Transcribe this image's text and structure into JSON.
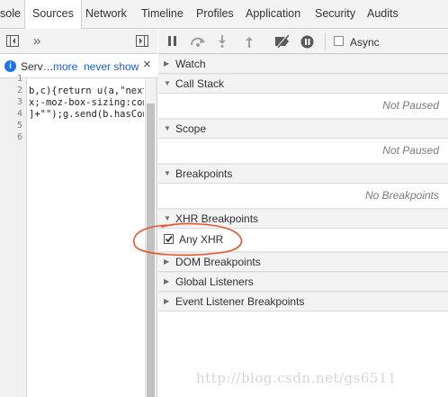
{
  "tabs": [
    {
      "label": "sole",
      "active": false
    },
    {
      "label": "Sources",
      "active": true
    },
    {
      "label": "Network",
      "active": false
    },
    {
      "label": "Timeline",
      "active": false
    },
    {
      "label": "Profiles",
      "active": false
    },
    {
      "label": "Application",
      "active": false
    },
    {
      "label": "Security",
      "active": false
    },
    {
      "label": "Audits",
      "active": false
    }
  ],
  "infobar": {
    "text": "Serv…",
    "more": "more",
    "never_show": "never show",
    "close": "×"
  },
  "editor": {
    "line_numbers": [
      "1",
      "2",
      "3",
      "4",
      "5",
      "6"
    ],
    "lines": [
      "",
      "b,c){return u(a,\"next\"",
      "x;-moz-box-sizing:cont",
      "]+\"\");g.send(b.hasCont",
      "",
      ""
    ]
  },
  "debugger_toolbar": {
    "async_label": "Async",
    "async_checked": false
  },
  "sections": {
    "watch": "Watch",
    "call_stack": {
      "label": "Call Stack",
      "status": "Not Paused"
    },
    "scope": {
      "label": "Scope",
      "status": "Not Paused"
    },
    "breakpoints": {
      "label": "Breakpoints",
      "status": "No Breakpoints"
    },
    "xhr_breakpoints": {
      "label": "XHR Breakpoints",
      "any_xhr_label": "Any XHR",
      "any_xhr_checked": true
    },
    "dom_breakpoints": "DOM Breakpoints",
    "global_listeners": "Global Listeners",
    "event_listener_breakpoints": "Event Listener Breakpoints"
  },
  "annotation_color": "#e4572e",
  "watermark": "http://blog.csdn.net/gs6511"
}
